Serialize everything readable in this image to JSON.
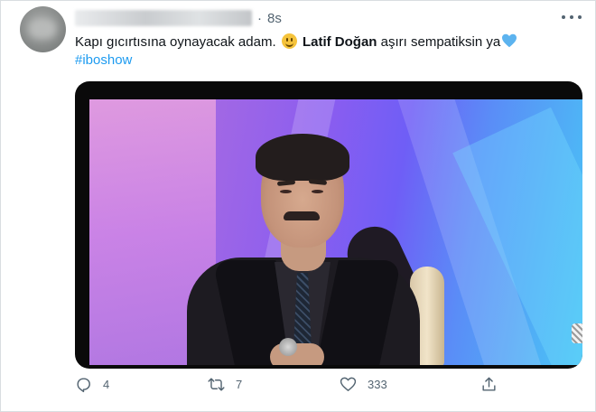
{
  "tweet": {
    "time_separator": "·",
    "time_ago": "8s",
    "text_before": "Kapı gıcırtısına oynayacak adam.",
    "emoji": "grinning-face-emoji",
    "mention_bold": "Latif Doğan",
    "text_after": "aşırı sempatiksin ya",
    "heart": "blue-heart-emoji",
    "hashtag": "#iboshow"
  },
  "actions": {
    "reply_count": "4",
    "retweet_count": "7",
    "like_count": "333"
  },
  "colors": {
    "link": "#1d9bf0",
    "secondary_text": "#536471",
    "primary_text": "#0f1419",
    "heart": "#5cb3ef"
  }
}
